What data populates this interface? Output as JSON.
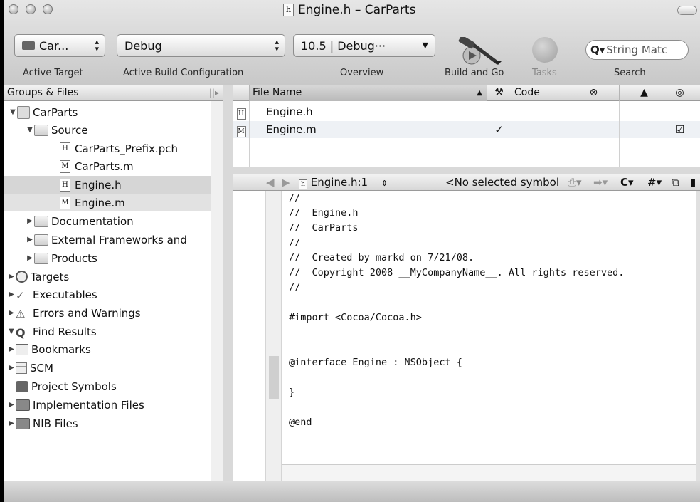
{
  "window": {
    "title": "Engine.h – CarParts",
    "title_icon": "h"
  },
  "toolbar": {
    "target_value": "Car...",
    "config_value": "Debug",
    "overview_value": "10.5 | Debug···",
    "search_placeholder": "String Matc",
    "labels": {
      "active_target": "Active Target",
      "active_config": "Active Build Configuration",
      "overview": "Overview",
      "build_and_go": "Build and Go",
      "tasks": "Tasks",
      "search": "Search"
    }
  },
  "groups": {
    "header": "Groups & Files",
    "items": [
      {
        "label": "CarParts"
      },
      {
        "label": "Source"
      },
      {
        "label": "CarParts_Prefix.pch",
        "icon": "H"
      },
      {
        "label": "CarParts.m",
        "icon": "M"
      },
      {
        "label": "Engine.h",
        "icon": "H"
      },
      {
        "label": "Engine.m",
        "icon": "M"
      },
      {
        "label": "Documentation"
      },
      {
        "label": "External Frameworks and"
      },
      {
        "label": "Products"
      },
      {
        "label": "Targets"
      },
      {
        "label": "Executables"
      },
      {
        "label": "Errors and Warnings"
      },
      {
        "label": "Find Results"
      },
      {
        "label": "Bookmarks"
      },
      {
        "label": "SCM"
      },
      {
        "label": "Project Symbols"
      },
      {
        "label": "Implementation Files"
      },
      {
        "label": "NIB Files"
      }
    ]
  },
  "filelist": {
    "columns": {
      "name": "File Name",
      "code": "Code"
    },
    "rows": [
      {
        "icon": "H",
        "name": "Engine.h",
        "built": "",
        "checked": ""
      },
      {
        "icon": "M",
        "name": "Engine.m",
        "built": "✓",
        "checked": "☑"
      }
    ]
  },
  "navbar": {
    "file": "Engine.h:1",
    "symbol": "<No selected symbol",
    "class_menu": "C",
    "hash_menu": "#"
  },
  "code": [
    "//",
    "//  Engine.h",
    "//  CarParts",
    "//",
    "//  Created by markd on 7/21/08.",
    "//  Copyright 2008 __MyCompanyName__. All rights reserved.",
    "//",
    "",
    "#import <Cocoa/Cocoa.h>",
    "",
    "",
    "@interface Engine : NSObject {",
    "",
    "}",
    "",
    "@end"
  ]
}
